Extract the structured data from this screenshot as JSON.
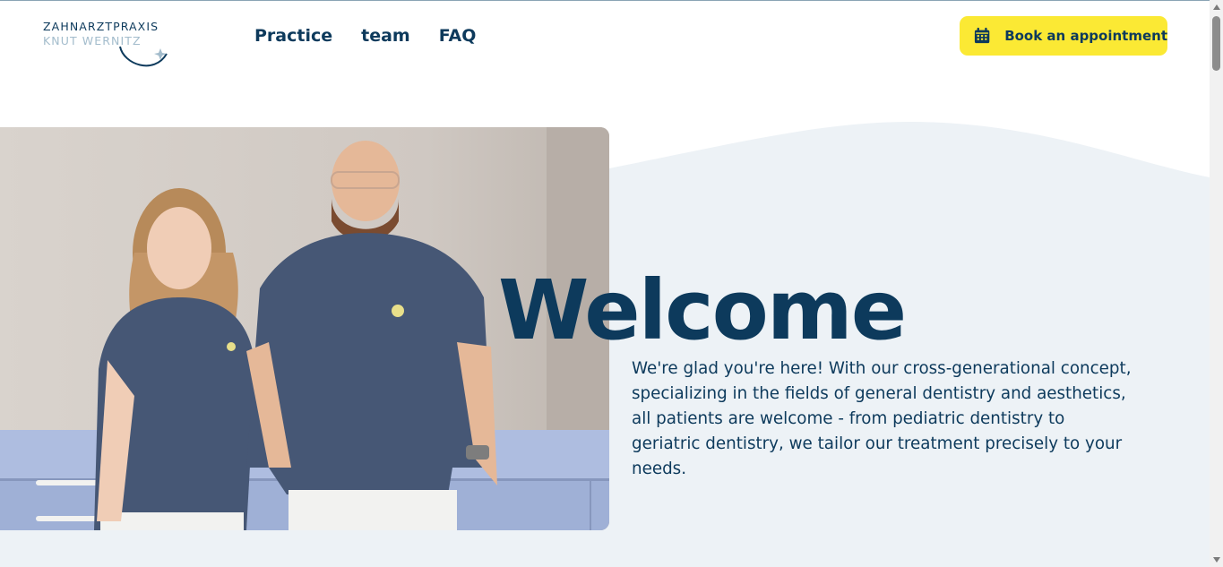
{
  "header": {
    "logo": {
      "line1": "ZAHNARZTPRAXIS",
      "line2": "KNUT WERNITZ"
    },
    "nav": [
      {
        "label": "Practice"
      },
      {
        "label": "team"
      },
      {
        "label": "FAQ"
      }
    ],
    "cta": {
      "label": "Book an appointment",
      "icon": "calendar-icon"
    }
  },
  "hero": {
    "heading": "Welcome",
    "intro": "We're glad you're here! With our cross-generational concept, specializing in the fields of general dentistry and aesthetics, all patients are welcome - from pediatric dentistry to geriatric dentistry, we tailor our treatment precisely to your needs."
  },
  "colors": {
    "brand_navy": "#0d3a5c",
    "accent_yellow": "#fbe934",
    "hero_bg": "#edf2f6",
    "logo_light": "#a3bccc"
  }
}
